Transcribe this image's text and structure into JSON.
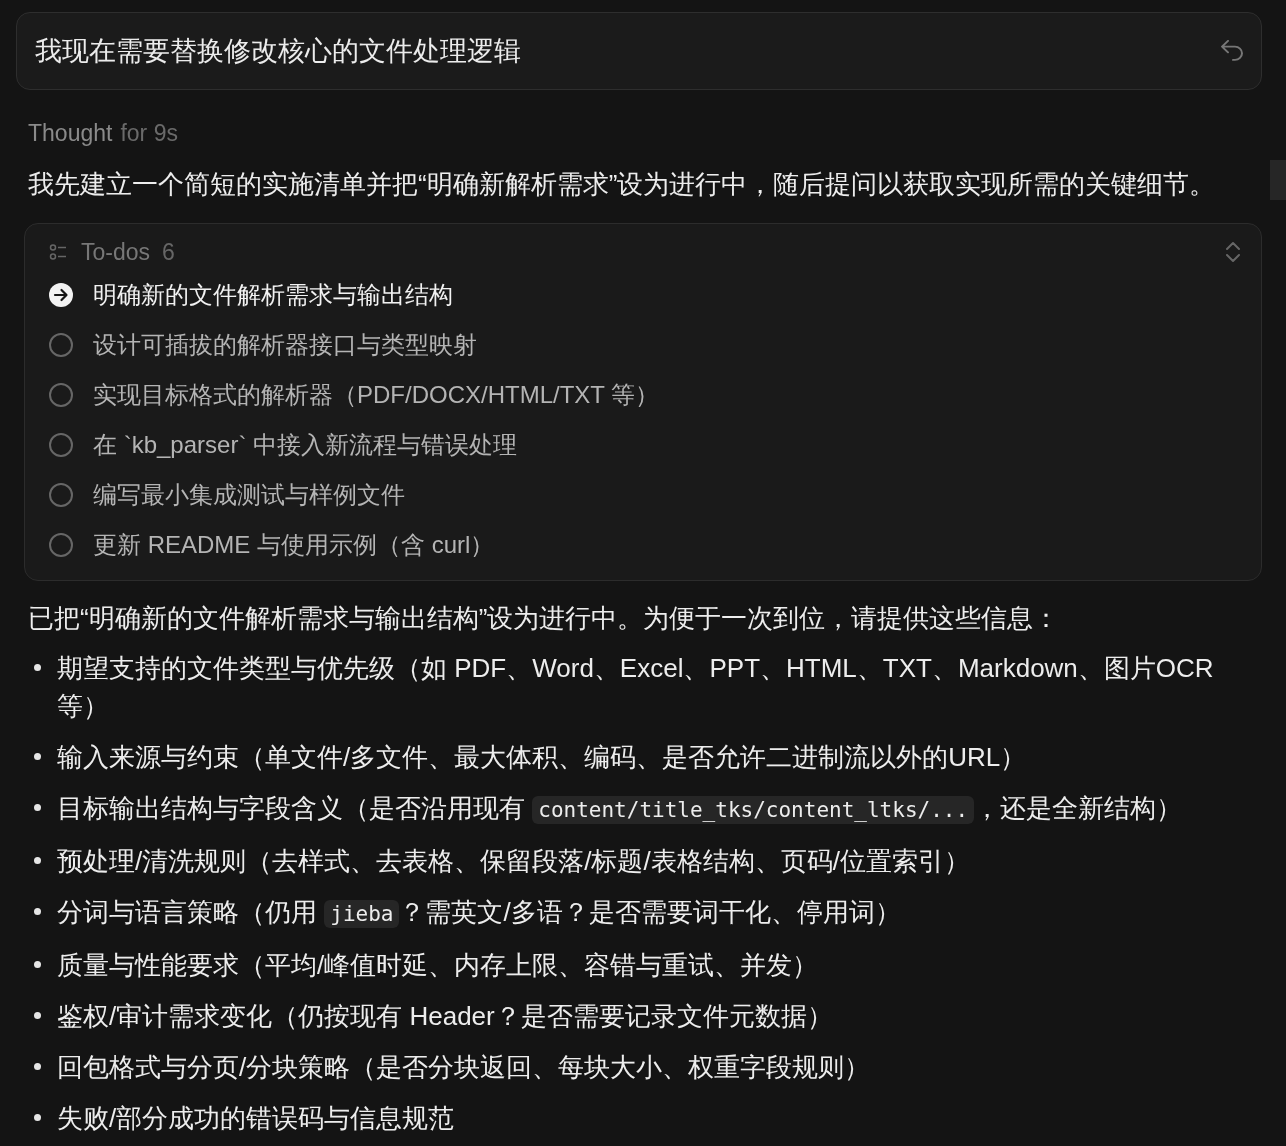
{
  "prompt": {
    "text": "我现在需要替换修改核心的文件处理逻辑"
  },
  "thought": {
    "label": "Thought",
    "duration": "for 9s"
  },
  "intro": "我先建立一个简短的实施清单并把“明确新解析需求”设为进行中，随后提问以获取实现所需的关键细节。",
  "todos": {
    "title": "To-dos",
    "count": "6",
    "expanded": true,
    "items": [
      {
        "text": "明确新的文件解析需求与输出结构",
        "in_progress": true
      },
      {
        "text": "设计可插拔的解析器接口与类型映射",
        "in_progress": false
      },
      {
        "text": "实现目标格式的解析器（PDF/DOCX/HTML/TXT 等）",
        "in_progress": false
      },
      {
        "text": "在 `kb_parser` 中接入新流程与错误处理",
        "in_progress": false
      },
      {
        "text": "编写最小集成测试与样例文件",
        "in_progress": false
      },
      {
        "text": "更新 README 与使用示例（含 curl）",
        "in_progress": false
      }
    ]
  },
  "answer": "已把“明确新的文件解析需求与输出结构”设为进行中。为便于一次到位，请提供这些信息：",
  "bullets": [
    [
      {
        "kind": "text",
        "text": "期望支持的文件类型与优先级（如 PDF、Word、Excel、PPT、HTML、TXT、Markdown、图片OCR 等）"
      }
    ],
    [
      {
        "kind": "text",
        "text": "输入来源与约束（单文件/多文件、最大体积、编码、是否允许二进制流以外的URL）"
      }
    ],
    [
      {
        "kind": "text",
        "text": "目标输出结构与字段含义（是否沿用现有 "
      },
      {
        "kind": "code",
        "text": "content/title_tks/content_ltks/..."
      },
      {
        "kind": "text",
        "text": "，还是全新结构）"
      }
    ],
    [
      {
        "kind": "text",
        "text": "预处理/清洗规则（去样式、去表格、保留段落/标题/表格结构、页码/位置索引）"
      }
    ],
    [
      {
        "kind": "text",
        "text": "分词与语言策略（仍用 "
      },
      {
        "kind": "code",
        "text": "jieba"
      },
      {
        "kind": "text",
        "text": "？需英文/多语？是否需要词干化、停用词）"
      }
    ],
    [
      {
        "kind": "text",
        "text": "质量与性能要求（平均/峰值时延、内存上限、容错与重试、并发）"
      }
    ],
    [
      {
        "kind": "text",
        "text": "鉴权/审计需求变化（仍按现有 Header？是否需要记录文件元数据）"
      }
    ],
    [
      {
        "kind": "text",
        "text": "回包格式与分页/分块策略（是否分块返回、每块大小、权重字段规则）"
      }
    ],
    [
      {
        "kind": "text",
        "text": "失败/部分成功的错误码与信息规范"
      }
    ]
  ]
}
